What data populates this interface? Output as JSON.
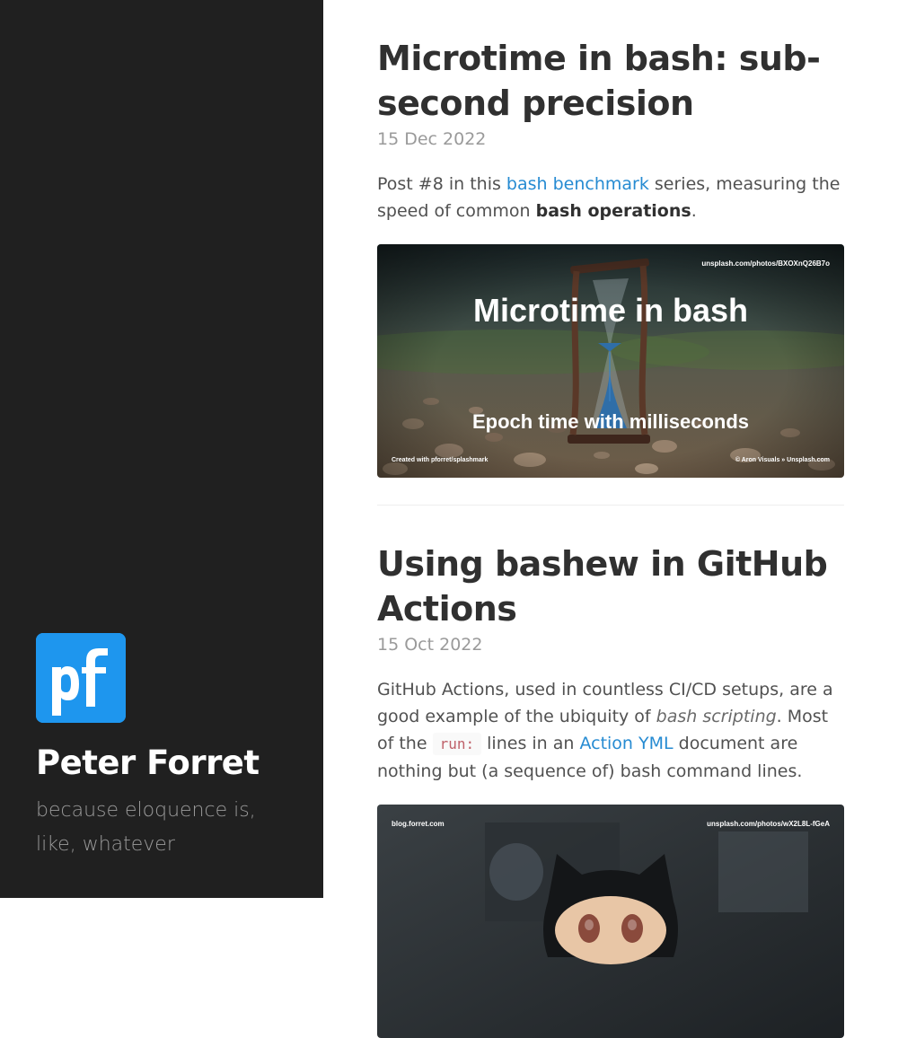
{
  "sidebar": {
    "logo_text": "pf",
    "site_title": "Peter Forret",
    "tagline": "because eloquence is, like, whatever"
  },
  "posts": [
    {
      "title": "Microtime in bash: sub-second precision",
      "date": "15 Dec 2022",
      "excerpt": {
        "t1": "Post #8 in this ",
        "link1": "bash benchmark",
        "t2": " series, measuring the speed of common ",
        "strong1": "bash operations",
        "t3": "."
      },
      "image": {
        "title": "Microtime in bash",
        "subtitle": "Epoch time with milliseconds",
        "top_right": "unsplash.com/photos/BXOXnQ26B7o",
        "bottom_left": "Created with pforret/splashmark",
        "bottom_right": "© Aron Visuals » Unsplash.com"
      }
    },
    {
      "title": "Using bashew in GitHub Actions",
      "date": "15 Oct 2022",
      "excerpt": {
        "t1": "GitHub Actions, used in countless CI/CD setups, are a good example of the ubiquity of ",
        "em1": "bash scripting",
        "t2": ". Most of the ",
        "code1": "run:",
        "t3": " lines in an ",
        "link1": "Action YML",
        "t4": " document are nothing but (a sequence of) bash command lines."
      },
      "image": {
        "top_left": "blog.forret.com",
        "top_right": "unsplash.com/photos/wX2L8L-fGeA"
      }
    }
  ],
  "colors": {
    "sidebar_bg": "#202020",
    "logo_bg": "#1e96ee",
    "link": "#268bd2",
    "code": "#bf616a"
  }
}
